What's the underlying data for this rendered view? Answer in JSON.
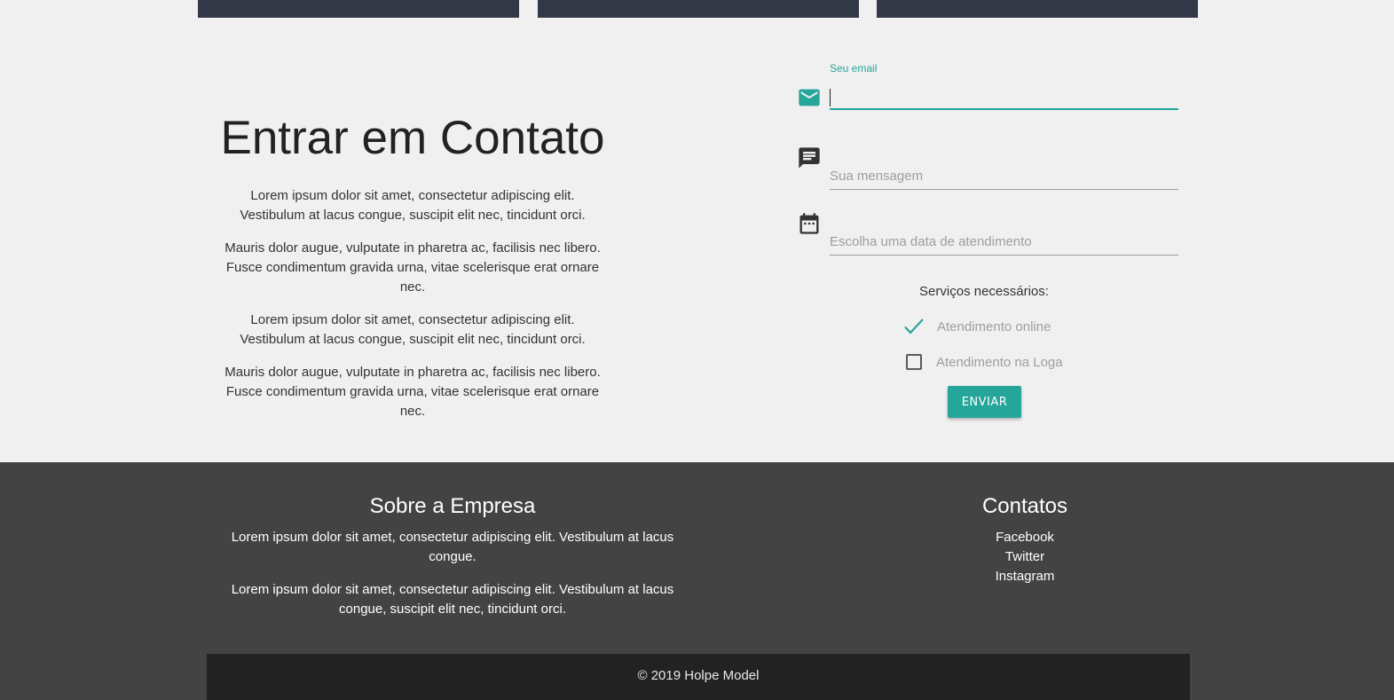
{
  "colors": {
    "accent": "#26a69a",
    "card_dark": "#323845",
    "footer_bg": "#434343",
    "copyright_bg": "#222222",
    "page_bg": "#f0f0f0"
  },
  "contact": {
    "title": "Entrar em Contato",
    "paragraphs": [
      "Lorem ipsum dolor sit amet, consectetur adipiscing elit. Vestibulum at lacus congue, suscipit elit nec, tincidunt orci.",
      "Mauris dolor augue, vulputate in pharetra ac, facilisis nec libero. Fusce condimentum gravida urna, vitae scelerisque erat ornare nec.",
      "Lorem ipsum dolor sit amet, consectetur adipiscing elit. Vestibulum at lacus congue, suscipit elit nec, tincidunt orci.",
      "Mauris dolor augue, vulputate in pharetra ac, facilisis nec libero. Fusce condimentum gravida urna, vitae scelerisque erat ornare nec."
    ]
  },
  "form": {
    "email": {
      "label": "Seu email",
      "value": "",
      "icon": "email-icon"
    },
    "message": {
      "placeholder": "Sua mensagem",
      "value": "",
      "icon": "message-icon"
    },
    "date": {
      "placeholder": "Escolha uma data de atendimento",
      "value": "",
      "icon": "calendar-icon"
    },
    "services_label": "Serviços necessários:",
    "services": [
      {
        "label": "Atendimento online",
        "checked": true
      },
      {
        "label": "Atendimento na Loga",
        "checked": false
      }
    ],
    "submit_label": "ENVIAR"
  },
  "footer": {
    "about_title": "Sobre a Empresa",
    "about_paragraphs": [
      "Lorem ipsum dolor sit amet, consectetur adipiscing elit. Vestibulum at lacus congue.",
      "Lorem ipsum dolor sit amet, consectetur adipiscing elit. Vestibulum at lacus congue, suscipit elit nec, tincidunt orci."
    ],
    "contacts_title": "Contatos",
    "links": [
      "Facebook",
      "Twitter",
      "Instagram"
    ],
    "copyright": "© 2019 Holpe Model"
  }
}
